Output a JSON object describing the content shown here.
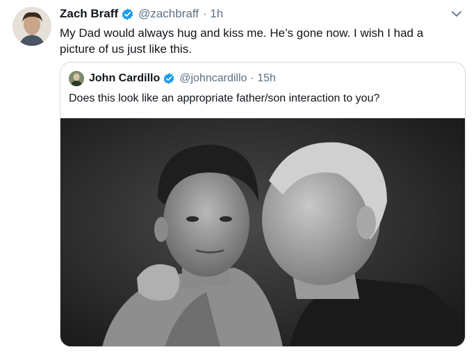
{
  "tweet": {
    "author_name": "Zach Braff",
    "handle": "@zachbraff",
    "time": "· 1h",
    "text": "My Dad would always hug and kiss me. He’s gone now. I wish I had a picture of us just like this."
  },
  "quoted_tweet": {
    "author_name": "John Cardillo",
    "handle": "@johncardillo",
    "time": "· 15h",
    "text": "Does this look like an appropriate father/son interaction to you?"
  },
  "icons": {
    "verified": "verified-badge-icon",
    "menu": "chevron-down-icon"
  },
  "colors": {
    "verified_blue": "#1d9bf0",
    "muted_text": "#5b7083",
    "border": "#cfd9de"
  }
}
